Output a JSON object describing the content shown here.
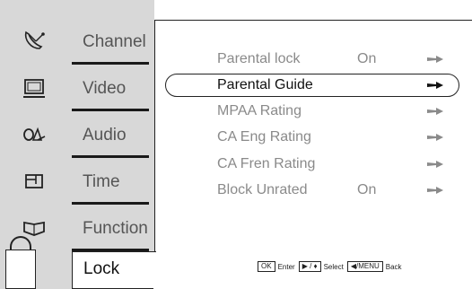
{
  "sidebar": {
    "items": [
      {
        "label": "Channel",
        "icon": "satellite-dish-icon"
      },
      {
        "label": "Video",
        "icon": "monitor-icon"
      },
      {
        "label": "Audio",
        "icon": "audio-icon"
      },
      {
        "label": "Time",
        "icon": "clock-icon"
      },
      {
        "label": "Function",
        "icon": "function-icon"
      },
      {
        "label": "Lock",
        "icon": "padlock-icon"
      }
    ]
  },
  "menu": {
    "rows": [
      {
        "label": "Parental lock",
        "value": "On"
      },
      {
        "label": "Parental Guide",
        "value": ""
      },
      {
        "label": "MPAA Rating",
        "value": ""
      },
      {
        "label": "CA Eng Rating",
        "value": ""
      },
      {
        "label": "CA Fren Rating",
        "value": ""
      },
      {
        "label": "Block Unrated",
        "value": "On"
      }
    ],
    "selected_index": 1
  },
  "footer": {
    "ok_key": "OK",
    "enter_label": "Enter",
    "nav_key": "▶ / ♦",
    "select_label": "Select",
    "menu_key": "◀/MENU",
    "back_label": "Back"
  }
}
